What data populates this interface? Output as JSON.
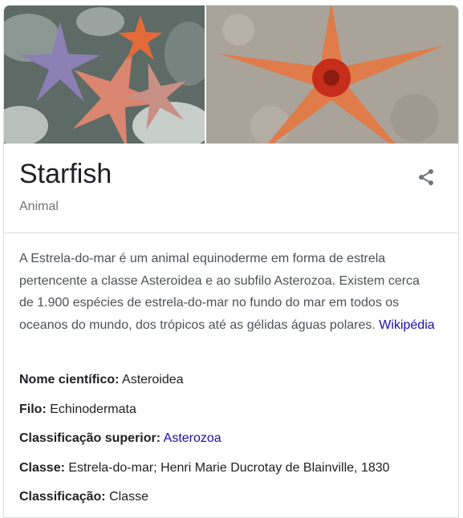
{
  "title": "Starfish",
  "subtitle": "Animal",
  "share_icon": "share-icon",
  "description": {
    "text": "A Estrela-do-mar é um animal equinoderme em forma de estrela pertencente a classe Asteroidea e ao subfilo Asterozoa. Existem cerca de 1.900 espécies de estrela-do-mar no fundo do mar em todos os oceanos do mundo, dos trópicos até as gélidas águas polares.",
    "source_link": "Wikipédia"
  },
  "facts": [
    {
      "label": "Nome científico:",
      "value": "Asteroidea"
    },
    {
      "label": "Filo:",
      "value": "Echinodermata"
    },
    {
      "label": "Classificação superior:",
      "value": "Asterozoa",
      "link": true
    },
    {
      "label": "Classe:",
      "value": "Estrela-do-mar; Henri Marie Ducrotay de Blainville, 1830"
    },
    {
      "label": "Classificação:",
      "value": "Classe"
    }
  ],
  "colors": {
    "link": "#1a0dab",
    "title": "#202124",
    "subtitle": "#70757a",
    "body": "#4d5156",
    "border": "#dadce0"
  }
}
